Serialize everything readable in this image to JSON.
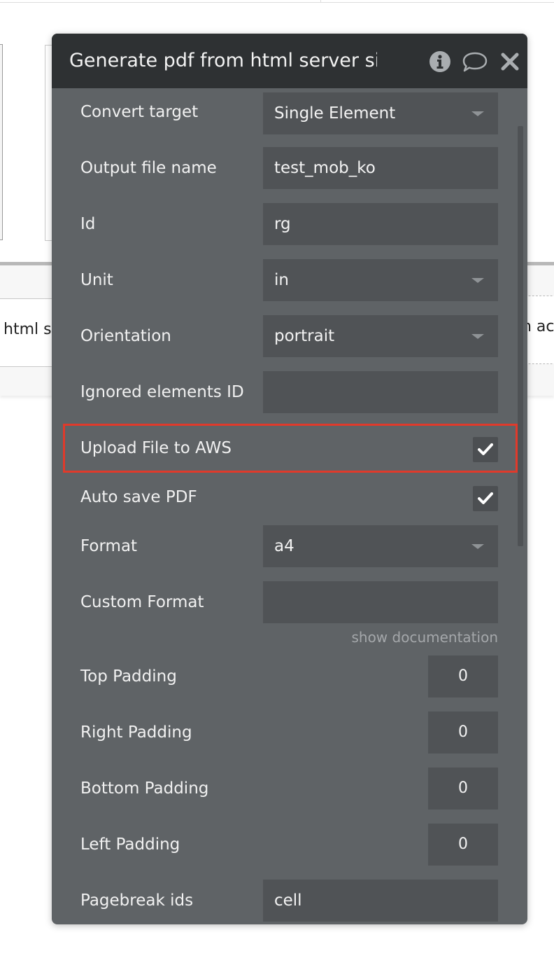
{
  "background": {
    "left_text": "html s",
    "right_text": "n ac"
  },
  "panel": {
    "title": "Generate pdf from html server side",
    "icons": [
      "info-icon",
      "comment-icon",
      "close-icon"
    ]
  },
  "fields": {
    "convert_target": {
      "label": "Convert target",
      "value": "Single Element"
    },
    "output_file_name": {
      "label": "Output file name",
      "value": "test_mob_ko"
    },
    "id": {
      "label": "Id",
      "value": "rg"
    },
    "unit": {
      "label": "Unit",
      "value": "in"
    },
    "orientation": {
      "label": "Orientation",
      "value": "portrait"
    },
    "ignored_elements_id": {
      "label": "Ignored elements ID",
      "value": ""
    },
    "upload_file_to_aws": {
      "label": "Upload File to AWS",
      "checked": true
    },
    "auto_save_pdf": {
      "label": "Auto save PDF",
      "checked": true
    },
    "format": {
      "label": "Format",
      "value": "a4"
    },
    "custom_format": {
      "label": "Custom Format",
      "value": ""
    },
    "show_documentation": "show documentation",
    "top_padding": {
      "label": "Top Padding",
      "value": "0"
    },
    "right_padding": {
      "label": "Right Padding",
      "value": "0"
    },
    "bottom_padding": {
      "label": "Bottom Padding",
      "value": "0"
    },
    "left_padding": {
      "label": "Left Padding",
      "value": "0"
    },
    "pagebreak_ids": {
      "label": "Pagebreak ids",
      "value": "cell"
    }
  },
  "colors": {
    "header": "#2e3133",
    "panel": "#5f6366",
    "field": "#505356",
    "highlight": "#e03a2b"
  }
}
